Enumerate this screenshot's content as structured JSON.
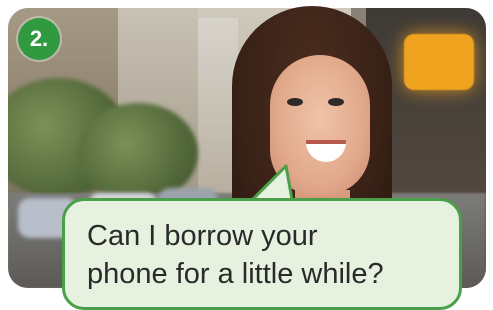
{
  "badge": {
    "text": "2."
  },
  "speech_bubble": {
    "line1": "Can I borrow your",
    "line2": "phone for a little while?"
  },
  "colors": {
    "badge_bg": "#2f9a3f",
    "bubble_bg": "#e6f2df",
    "bubble_border": "#4a9f49"
  }
}
